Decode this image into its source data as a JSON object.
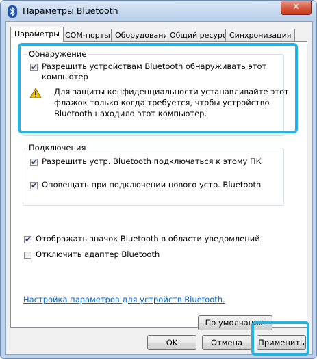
{
  "window": {
    "title": "Параметры Bluetooth",
    "close_label": "✕"
  },
  "tabs": [
    {
      "label": "Параметры",
      "active": true
    },
    {
      "label": "COM-порты"
    },
    {
      "label": "Оборудование"
    },
    {
      "label": "Общий ресурс"
    },
    {
      "label": "Синхронизация"
    }
  ],
  "discovery": {
    "group_label": "Обнаружение",
    "allow_discovery": {
      "line1": "Разрешить устройствам Bluetooth обнаруживать этот",
      "line2": "компьютер",
      "checked": true
    },
    "warning": {
      "line1": "Для защиты конфиденциальности устанавливайте этот",
      "line2": "флажок только когда требуется, чтобы устройство",
      "line3": "Bluetooth находило этот компьютер."
    }
  },
  "connections": {
    "group_label": "Подключения",
    "allow_connect": {
      "label": "Разрешить устр. Bluetooth подключаться к этому ПК",
      "checked": true
    },
    "notify_new": {
      "label": "Оповещать при подключении нового устр. Bluetooth",
      "checked": true
    }
  },
  "show_icon": {
    "label": "Отображать значок Bluetooth в области уведомлений",
    "checked": true
  },
  "disable_adapter": {
    "label": "Отключить адаптер Bluetooth",
    "checked": false
  },
  "settings_link": "Настройка параметров для устройств Bluetooth.",
  "buttons": {
    "defaults": "По умолчанию",
    "ok": "OK",
    "cancel": "Отмена",
    "apply": "Применить"
  },
  "colors": {
    "highlight": "#27b3e0",
    "link": "#0066cc",
    "warning": "#f2c200"
  }
}
